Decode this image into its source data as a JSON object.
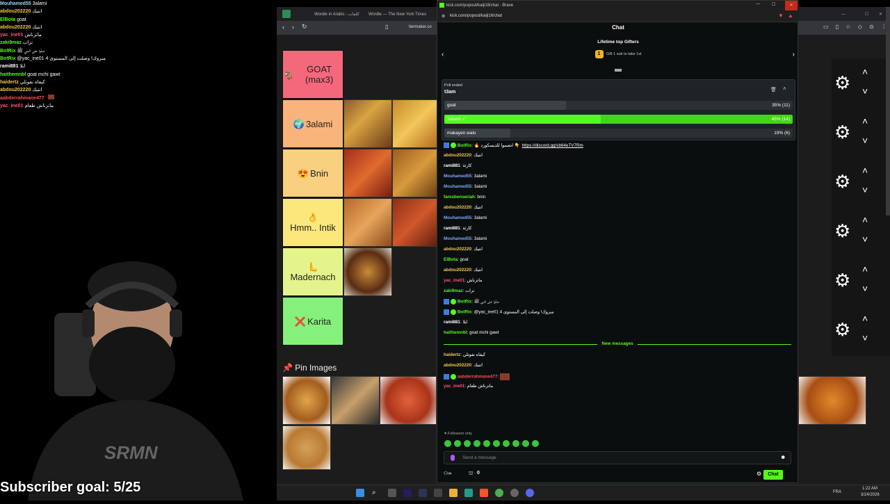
{
  "overlay_chat": [
    {
      "user": "Mouhamed55",
      "text": "3alami",
      "color": "#9ad5ff"
    },
    {
      "user": "abdou202220",
      "text": "انتيك",
      "color": "#f2c94c"
    },
    {
      "user": "ElBota",
      "text": "goat",
      "color": "#53fc18"
    },
    {
      "user": "abdou202220",
      "text": "انتيك",
      "color": "#f2c94c"
    },
    {
      "user": "yac_ine01",
      "text": "ماتزناش",
      "color": "#ff5577"
    },
    {
      "user": "zaki9maz",
      "text": "ترات",
      "color": "#53fc18"
    },
    {
      "user": "BotRix",
      "text": "صلّوا على النبي ﷺ",
      "color": "#53fc18"
    },
    {
      "user": "BotRix",
      "text": "@yac_ine01 مبروك! وصلت إلى المستوى 4",
      "color": "#53fc18"
    },
    {
      "user": "rami881",
      "text": "ايلا",
      "color": "#ffffff"
    },
    {
      "user": "haithemnbl",
      "text": "goat mchi gawt",
      "color": "#53fc18"
    },
    {
      "user": "haidertz",
      "text": "كيفاه نفوتلي",
      "color": "#f2c94c"
    },
    {
      "user": "abdou202220",
      "text": "انتيك",
      "color": "#f2c94c"
    },
    {
      "user": "aabderrahmane477",
      "text": "",
      "color": "#ff4d4d"
    },
    {
      "user": "yac_ine01",
      "text": "ماتزناش طعام",
      "color": "#ff5577"
    }
  ],
  "back_browser": {
    "tabs": [
      "Wordle in Arabic - كلمات",
      "Wordle — The New York Times"
    ],
    "address": "tiermaker.co"
  },
  "tiers": [
    {
      "emoji": "🐐",
      "label": "GOAT (max3)",
      "color": "#f5687c"
    },
    {
      "emoji": "🌍",
      "label": "3alami",
      "color": "#f8b47a"
    },
    {
      "emoji": "😍",
      "label": "Bnin",
      "color": "#f9d07f"
    },
    {
      "emoji": "👌",
      "label": "Hmm.. Intik",
      "color": "#fbe77c"
    },
    {
      "emoji": "🫷",
      "label": "Madernach",
      "color": "#e5f48a"
    },
    {
      "emoji": "❌",
      "label": "Karita",
      "color": "#86f17a"
    }
  ],
  "pin_images_label": "Pin Images",
  "popout": {
    "title": "kick.com/popout/kaiji16/chat - Brave",
    "address": "kick.com/popout/kaiji16/chat",
    "header": "Chat",
    "gifters_title": "Lifetime top Gifters",
    "gifters_sub": "Gift 1 sub to take 1st",
    "gift_rank": "1",
    "poll": {
      "status": "Poll ended",
      "question": "t3am",
      "options": [
        {
          "label": "goat",
          "pct_text": "35% (11)",
          "fraction": 0.35,
          "winner": false
        },
        {
          "label": "3alami",
          "pct_text": "45% (14)",
          "fraction": 0.45,
          "winner": true
        },
        {
          "label": "makayen walo",
          "pct_text": "19% (6)",
          "fraction": 0.19,
          "winner": false
        }
      ]
    },
    "messages": [
      {
        "user": "BotRix",
        "text": "🔥 انضموا للديسكورد 👇",
        "link": "https://discord.gg/sb64eTV7Rm",
        "color": "#53fc18",
        "badges": true
      },
      {
        "user": "abdou202220",
        "text": "انتيك",
        "color": "#f2c94c"
      },
      {
        "user": "rami881",
        "text": "كارثة",
        "color": "#ffffff"
      },
      {
        "user": "Mouhamed55",
        "text": "3alami",
        "color": "#7aa7ff"
      },
      {
        "user": "Mouhamed55",
        "text": "3alami",
        "color": "#7aa7ff"
      },
      {
        "user": "faresbenseriah",
        "text": "bnin",
        "color": "#53fc18"
      },
      {
        "user": "abdou202220",
        "text": "انتيك",
        "color": "#f2c94c"
      },
      {
        "user": "Mouhamed55",
        "text": "3alami",
        "color": "#7aa7ff"
      },
      {
        "user": "rami881",
        "text": "كارثة",
        "color": "#ffffff"
      },
      {
        "user": "Mouhamed55",
        "text": "3alami",
        "color": "#7aa7ff"
      },
      {
        "user": "abdou202220",
        "text": "انتيك",
        "color": "#f2c94c"
      },
      {
        "user": "ElBota",
        "text": "goat",
        "color": "#53fc18"
      },
      {
        "user": "abdou202220",
        "text": "انتيك",
        "color": "#f2c94c"
      },
      {
        "user": "yac_ine01",
        "text": "ماتزناش",
        "color": "#ff5577"
      },
      {
        "user": "zaki9maz",
        "text": "ترات",
        "color": "#53fc18"
      },
      {
        "user": "BotRix",
        "text": "صلّوا على النبي ﷺ",
        "color": "#53fc18",
        "badges": true
      },
      {
        "user": "BotRix",
        "text": "@yac_ine01 مبروك! وصلت إلى المستوى 4",
        "color": "#53fc18",
        "badges": true
      },
      {
        "user": "rami881",
        "text": "ايلا",
        "color": "#ffffff"
      },
      {
        "user": "haithemnbl",
        "text": "goat mchi gawt",
        "color": "#53fc18"
      }
    ],
    "new_messages_label": "New messages",
    "new_messages": [
      {
        "user": "haidertz",
        "text": "كيفاه نفوتلي",
        "color": "#f2c94c"
      },
      {
        "user": "abdou202220",
        "text": "انتيك",
        "color": "#f2c94c"
      },
      {
        "user": "aabderrahmane477",
        "text": "",
        "color": "#ff4d4d",
        "badges": true
      },
      {
        "user": "yac_ine01",
        "text": "ماتزناش طعام",
        "color": "#ff5577"
      }
    ],
    "followers_only": "Followers only",
    "send_placeholder": "Send a message",
    "viewer_count": "0",
    "chat_button": "Chat"
  },
  "subscriber_goal": "Subscriber goal: 5/25",
  "taskbar": {
    "lang": "FRA",
    "time": "1:22 AM",
    "date": "3/24/2026"
  }
}
